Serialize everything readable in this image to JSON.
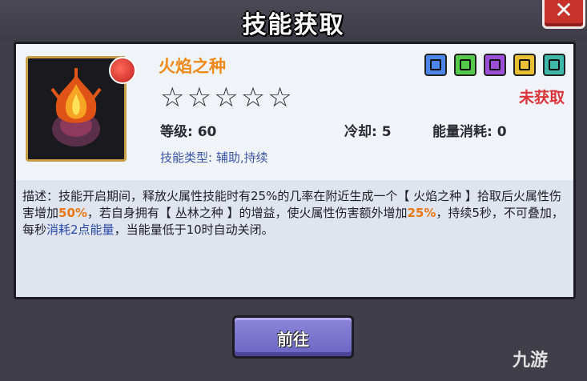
{
  "dialog": {
    "title": "技能获取",
    "close_label": "✕"
  },
  "skill": {
    "name": "火焰之种",
    "stars_total": 5,
    "stars_filled": 0,
    "status": "未获取",
    "level_label": "等级: 60",
    "cooldown_label": "冷却: 5",
    "energy_label": "能量消耗: 0",
    "type_label": "技能类型: 辅助,持续",
    "element_badges": [
      {
        "icon": "shield-icon",
        "color": "#4c86e6"
      },
      {
        "icon": "arrow-up-icon",
        "color": "#55c94a"
      },
      {
        "icon": "boot-icon",
        "color": "#9a4fd6"
      },
      {
        "icon": "trophy-icon",
        "color": "#e8c032"
      },
      {
        "icon": "sword-icon",
        "color": "#3fb7a9"
      }
    ]
  },
  "description": {
    "part1": "描述：技能开启期间，释放火属性技能时有25%的几率在附近生成一个【 火焰之种 】拾取后火属性伤害增加",
    "value1": "50%",
    "part2": "，若自身拥有【 丛林之种 】的增益，使火属性伤害额外增加",
    "value2": "25%",
    "part3": "，持续5秒，不可叠加，每秒",
    "value3": "消耗2点能量",
    "part4": "，当能量低于10时自动关闭。"
  },
  "actions": {
    "go_label": "前往"
  },
  "watermark": {
    "text": "九游"
  }
}
